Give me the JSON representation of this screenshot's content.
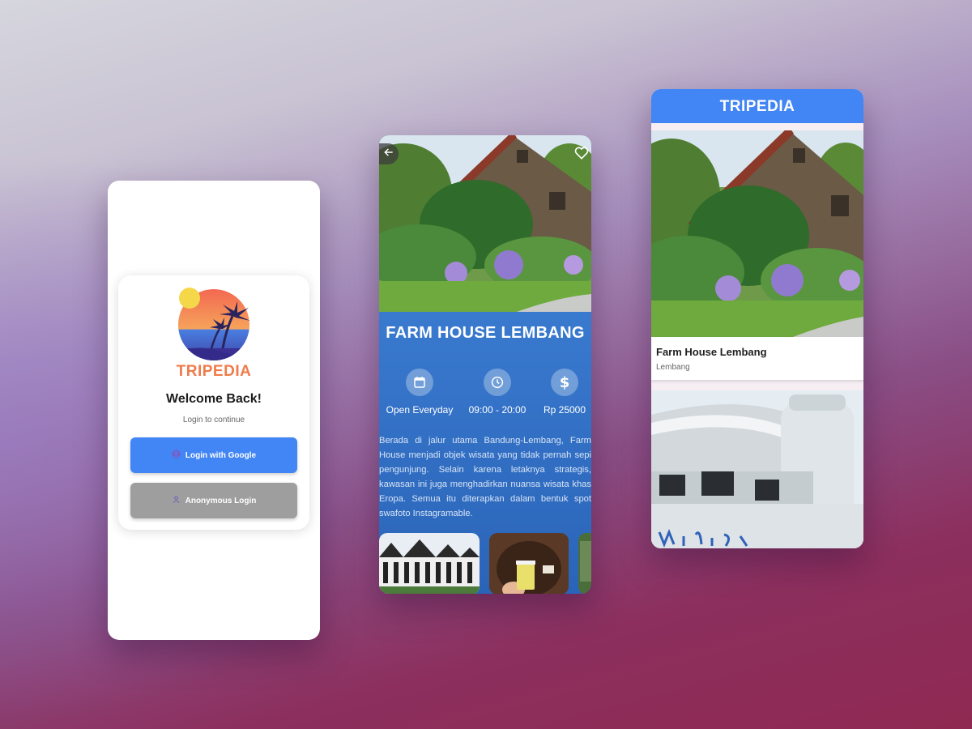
{
  "login": {
    "brand": "TRIPEDIA",
    "welcome": "Welcome Back!",
    "subtitle": "Login to continue",
    "google_button": "Login with Google",
    "anon_button": "Anonymous Login",
    "icons": [
      "account-circle-icon",
      "person-icon"
    ]
  },
  "detail": {
    "title": "FARM HOUSE LEMBANG",
    "info": [
      {
        "icon": "calendar-icon",
        "label": "Open Everyday"
      },
      {
        "icon": "clock-icon",
        "label": "09:00 - 20:00"
      },
      {
        "icon": "dollar-icon",
        "label": "Rp 25000"
      }
    ],
    "description": "Berada di jalur utama Bandung-Lembang, Farm House menjadi objek wisata yang tidak pernah sepi pengunjung. Selain karena letaknya strategis, kawasan ini juga menghadirkan nuansa wisata khas Eropa. Semua itu diterapkan dalam bentuk spot swafoto Instagramable."
  },
  "list": {
    "header": "TRIPEDIA",
    "items": [
      {
        "name": "Farm House Lembang",
        "location": "Lembang"
      }
    ]
  },
  "colors": {
    "primary": "#4285f4",
    "brand_orange": "#f07b4a",
    "anon_gray": "#9e9e9e",
    "detail_blue": "#3a7bd0"
  }
}
